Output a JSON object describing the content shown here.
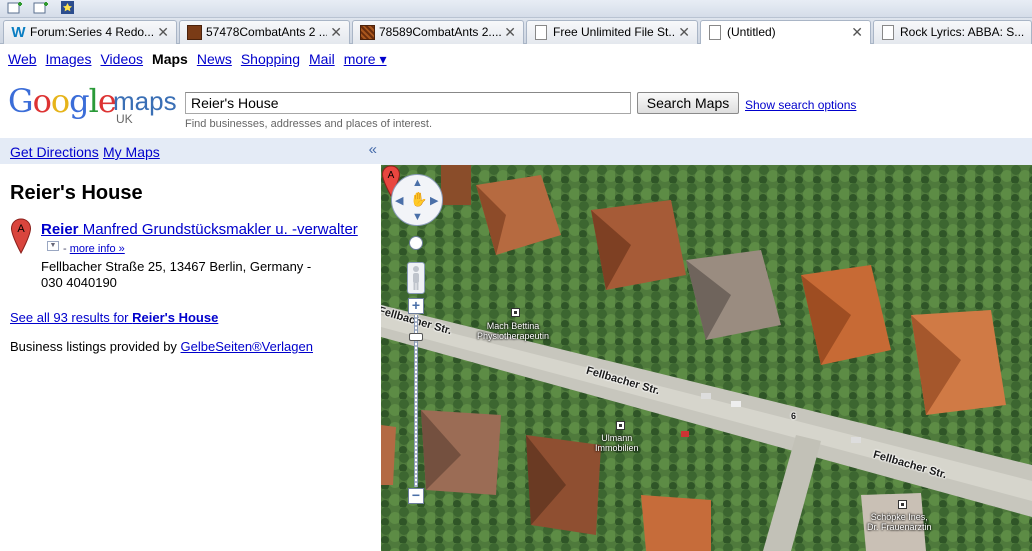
{
  "browser": {
    "tabs": [
      {
        "title": "Forum:Series 4 Redo...",
        "favicon": "w-icon",
        "active": false
      },
      {
        "title": "57478CombatAnts 2 ...",
        "favicon": "image-icon",
        "active": false
      },
      {
        "title": "78589CombatAnts 2....",
        "favicon": "image-icon",
        "active": false
      },
      {
        "title": "Free Unlimited File St...",
        "favicon": "document-icon",
        "active": false
      },
      {
        "title": "(Untitled)",
        "favicon": "document-icon",
        "active": false
      },
      {
        "title": "Rock Lyrics: ABBA: S...",
        "favicon": "document-icon",
        "active": false
      }
    ]
  },
  "gnav": {
    "web": "Web",
    "images": "Images",
    "videos": "Videos",
    "maps": "Maps",
    "news": "News",
    "shopping": "Shopping",
    "mail": "Mail",
    "more": "more ▾"
  },
  "header": {
    "logo_maps": "maps",
    "logo_region": "UK",
    "search_value": "Reier's House",
    "search_button": "Search Maps",
    "search_options": "Show search options",
    "hint": "Find businesses, addresses and places of interest."
  },
  "panel": {
    "get_directions": "Get Directions",
    "my_maps": "My Maps",
    "collapse": "«",
    "title": "Reier's House",
    "marker_letter": "A",
    "result_bold": "Reier",
    "result_rest": " Manfred Grundstücksmakler u. -verwalter",
    "more_info": "more info »",
    "more_info_prefix": "- ",
    "address": "Fellbacher Straße 25, 13467 Berlin, Germany -",
    "phone": "030 4040190",
    "see_all_prefix": "See all 93 results for ",
    "see_all_bold": "Reier's House",
    "listing_prefix": "Business listings provided by ",
    "listing_link": "GelbeSeiten®Verlagen"
  },
  "map": {
    "streets": [
      "Fellbacher Str.",
      "Fellbacher Str.",
      "Fellbacher Str."
    ],
    "pois": [
      {
        "line1": "Mach Bettina",
        "line2": "Physiotherapeutin"
      },
      {
        "line1": "Ulmann",
        "line2": "Immobilien"
      },
      {
        "line1": "Schöpke Ines,",
        "line2": "Dr. Frauenärztin"
      }
    ],
    "house_number": "6",
    "pin_letter": "A"
  },
  "colors": {
    "link": "#0000cc",
    "panel_band": "#e4ebf6",
    "marker_red": "#d9453d"
  }
}
